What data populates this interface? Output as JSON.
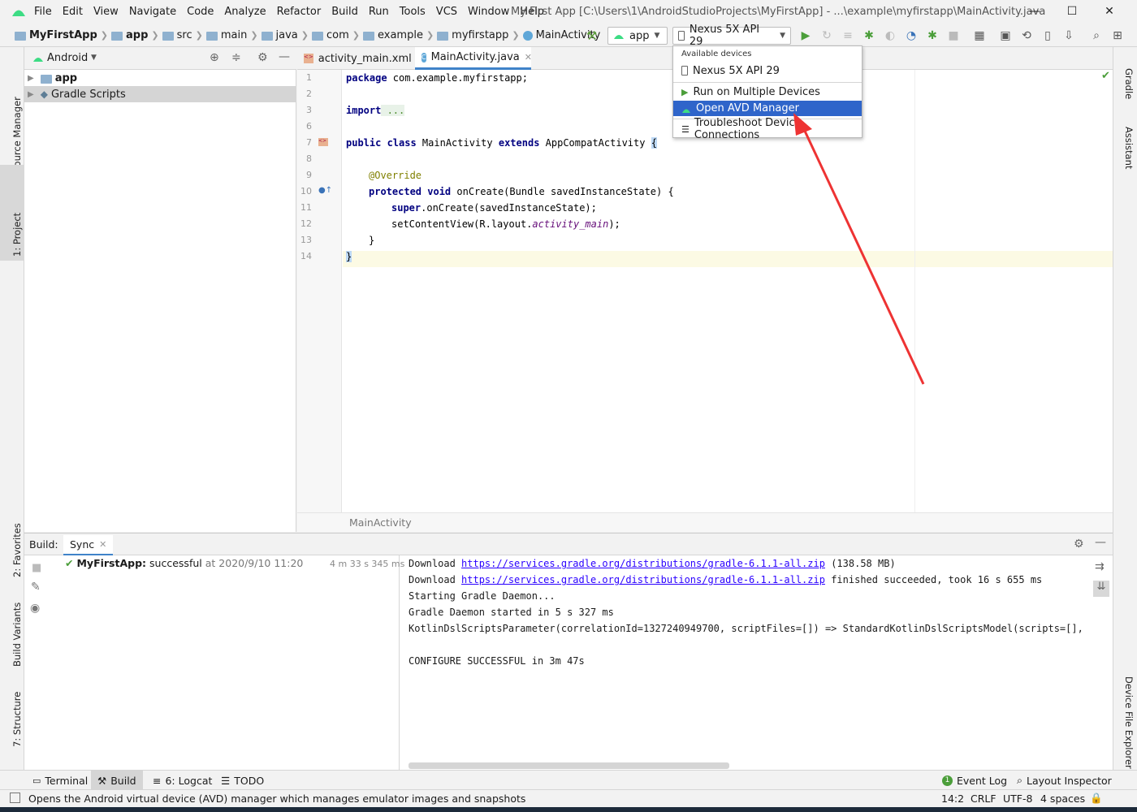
{
  "menu": [
    "File",
    "Edit",
    "View",
    "Navigate",
    "Code",
    "Analyze",
    "Refactor",
    "Build",
    "Run",
    "Tools",
    "VCS",
    "Window",
    "Help"
  ],
  "window_title": "My First App [C:\\Users\\1\\AndroidStudioProjects\\MyFirstApp] - ...\\example\\myfirstapp\\MainActivity.java",
  "breadcrumb": [
    "MyFirstApp",
    "app",
    "src",
    "main",
    "java",
    "com",
    "example",
    "myfirstapp",
    "MainActivity"
  ],
  "toolbar": {
    "config": "app",
    "device": "Nexus 5X API 29"
  },
  "device_menu": {
    "header": "Available devices",
    "items": [
      "Nexus 5X API 29",
      "Run on Multiple Devices",
      "Open AVD Manager",
      "Troubleshoot Device Connections"
    ]
  },
  "left_strip": [
    "Resource Manager",
    "1: Project",
    "2: Favorites",
    "Build Variants",
    "7: Structure"
  ],
  "right_strip": [
    "Gradle",
    "Assistant",
    "Device File Explorer"
  ],
  "project": {
    "view": "Android",
    "items": [
      "app",
      "Gradle Scripts"
    ]
  },
  "editor": {
    "tabs": [
      "activity_main.xml",
      "MainActivity.java"
    ],
    "line_numbers": [
      "1",
      "2",
      "3",
      "6",
      "7",
      "8",
      "9",
      "10",
      "11",
      "12",
      "13",
      "14"
    ],
    "code": {
      "l1_kw": "package",
      "l1": " com.example.myfirstapp;",
      "l3_kw": "import",
      "l3": " ...",
      "l7_kw1": "public class",
      "l7_a": " MainActivity ",
      "l7_kw2": "extends",
      "l7_b": " AppCompatActivity ",
      "l7_c": "{",
      "l9": "@Override",
      "l10_kw": "protected void",
      "l10": " onCreate(Bundle savedInstanceState) {",
      "l11_kw": "super",
      "l11": ".onCreate(savedInstanceState);",
      "l12_a": "setContentView(R.layout.",
      "l12_it": "activity_main",
      "l12_b": ");",
      "l13": "}",
      "l14": "}"
    },
    "footer": "MainActivity"
  },
  "build": {
    "label": "Build:",
    "tab": "Sync",
    "result_name": "MyFirstApp:",
    "result_status": " successful",
    "result_time": " at 2020/9/10 11:20",
    "duration": "4 m 33 s 345 ms",
    "console": {
      "c1_a": "Download ",
      "c1_link": "https://services.gradle.org/distributions/gradle-6.1.1-all.zip",
      "c1_b": " (138.58 MB)",
      "c2_a": "Download ",
      "c2_link": "https://services.gradle.org/distributions/gradle-6.1.1-all.zip",
      "c2_b": " finished succeeded, took 16 s 655 ms",
      "c3": "Starting Gradle Daemon...",
      "c4": "Gradle Daemon started in 5 s 327 ms",
      "c5": "KotlinDslScriptsParameter(correlationId=1327240949700, scriptFiles=[]) => StandardKotlinDslScriptsModel(scripts=[], comm",
      "c6": "CONFIGURE SUCCESSFUL in 3m 47s"
    }
  },
  "bottom_tabs": [
    "Terminal",
    "Build",
    "6: Logcat",
    "TODO"
  ],
  "bottom_right": [
    "Event Log",
    "Layout Inspector"
  ],
  "status": {
    "message": "Opens the Android virtual device (AVD) manager which manages emulator images and snapshots",
    "position": "14:2",
    "line_sep": "CRLF",
    "encoding": "UTF-8",
    "indent": "4 spaces"
  },
  "colors": {
    "selection": "#2f65ca",
    "arrow": "#ee3333",
    "android_green": "#3ddc84"
  }
}
